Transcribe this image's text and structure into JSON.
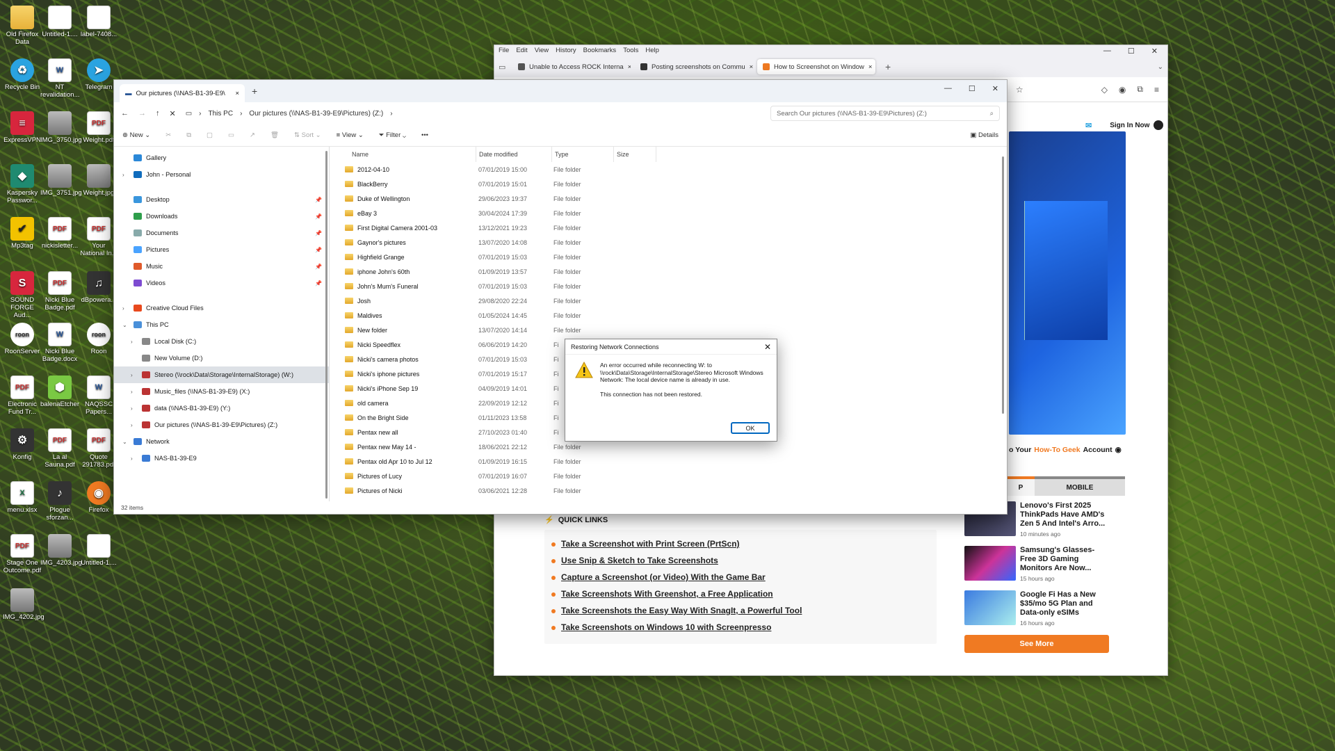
{
  "desktop": {
    "icons": [
      {
        "label": "Old Firefox Data",
        "icon": "folder-icon"
      },
      {
        "label": "Untitled-1....",
        "icon": "document-icon"
      },
      {
        "label": "label-7408...",
        "icon": "document-icon"
      },
      {
        "label": "Recycle Bin",
        "icon": "recycle-bin-icon"
      },
      {
        "label": "NT revalidation...",
        "icon": "word-icon"
      },
      {
        "label": "Telegram",
        "icon": "telegram-icon"
      },
      {
        "label": "ExpressVPN",
        "icon": "expressvpn-icon"
      },
      {
        "label": "IMG_3750.jpg",
        "icon": "image-icon"
      },
      {
        "label": "Weight.pdf",
        "icon": "pdf-icon"
      },
      {
        "label": "Kaspersky Passwor...",
        "icon": "kaspersky-icon"
      },
      {
        "label": "IMG_3751.jpg",
        "icon": "image-icon"
      },
      {
        "label": "Weight.jpg",
        "icon": "image-icon"
      },
      {
        "label": "Mp3tag",
        "icon": "mp3tag-icon"
      },
      {
        "label": "nickisletter...",
        "icon": "pdf-icon"
      },
      {
        "label": "Your National In...",
        "icon": "pdf-icon"
      },
      {
        "label": "SOUND FORGE Aud...",
        "icon": "sound-forge-icon"
      },
      {
        "label": "Nicki Blue Badge.pdf",
        "icon": "pdf-icon"
      },
      {
        "label": "dBpowera...",
        "icon": "dbpoweramp-icon"
      },
      {
        "label": "RoonServer",
        "icon": "roon-icon"
      },
      {
        "label": "Nicki Blue Badge.docx",
        "icon": "word-icon"
      },
      {
        "label": "Roon",
        "icon": "roon-icon"
      },
      {
        "label": "Electronic Fund Tr...",
        "icon": "pdf-icon"
      },
      {
        "label": "balenaEtcher",
        "icon": "balena-icon"
      },
      {
        "label": "NAQSSC Papers...",
        "icon": "word-icon"
      },
      {
        "label": "Konfig",
        "icon": "konfig-icon"
      },
      {
        "label": "La al Sauna.pdf",
        "icon": "pdf-icon"
      },
      {
        "label": "Quote 291783.pdf",
        "icon": "pdf-icon"
      },
      {
        "label": "menu.xlsx",
        "icon": "excel-icon"
      },
      {
        "label": "Plogue sforzan...",
        "icon": "plogue-icon"
      },
      {
        "label": "Firefox",
        "icon": "firefox-icon"
      },
      {
        "label": "Stage One Outcome.pdf",
        "icon": "pdf-icon"
      },
      {
        "label": "IMG_4203.jpg",
        "icon": "image-icon"
      },
      {
        "label": "Untitled-1....",
        "icon": "document-icon"
      },
      {
        "label": "IMG_4202.jpg",
        "icon": "image-icon"
      }
    ]
  },
  "browser": {
    "menu": [
      "File",
      "Edit",
      "View",
      "History",
      "Bookmarks",
      "Tools",
      "Help"
    ],
    "tabs": [
      {
        "label": "Unable to Access ROCK Interna",
        "close": "×"
      },
      {
        "label": "Posting screenshots on Commu",
        "close": "×"
      },
      {
        "label": "How to Screenshot on Window",
        "close": "×"
      }
    ],
    "new_tab": "+",
    "sign_in": "Sign In Now",
    "newsletter": {
      "prefix": "o Your",
      "brand": "How-To Geek",
      "suffix": "Account"
    },
    "rail_tabs": {
      "first": "P",
      "second": "MOBILE"
    },
    "quick_links": {
      "title": "QUICK LINKS",
      "items": [
        "Take a Screenshot with Print Screen (PrtScn)",
        "Use Snip & Sketch to Take Screenshots",
        "Capture a Screenshot (or Video) With the Game Bar",
        "Take Screenshots With Greenshot, a Free Application",
        "Take Screenshots the Easy Way With SnagIt, a Powerful Tool",
        "Take Screenshots on Windows 10 with Screenpresso"
      ]
    },
    "stories": [
      {
        "headline": "Lenovo's First 2025 ThinkPads Have AMD's Zen 5 And Intel's Arro...",
        "time": "10 minutes ago"
      },
      {
        "headline": "Samsung's Glasses-Free 3D Gaming Monitors Are Now...",
        "time": "15 hours ago"
      },
      {
        "headline": "Google Fi Has a New $35/mo 5G Plan and Data-only eSIMs",
        "time": "16 hours ago"
      }
    ],
    "see_more": "See More",
    "colors": {
      "accent": "#f07a22"
    }
  },
  "explorer": {
    "tab_title": "Our pictures (\\\\NAS-B1-39-E9\\",
    "tab_close": "×",
    "new_tab": "+",
    "breadcrumb": [
      "This PC",
      "Our pictures (\\\\NAS-B1-39-E9\\Pictures) (Z:)"
    ],
    "search_placeholder": "Search Our pictures (\\\\NAS-B1-39-E9\\Pictures) (Z:)",
    "toolbar": {
      "new": "New",
      "sort": "Sort",
      "view": "View",
      "filter": "Filter",
      "more": "•••",
      "details": "Details"
    },
    "nav": [
      {
        "label": "Gallery",
        "icon": "gallery-icon",
        "chev": "",
        "pin": false
      },
      {
        "label": "John - Personal",
        "icon": "onedrive-icon",
        "chev": "›",
        "pin": false
      },
      {
        "sep": true
      },
      {
        "label": "Desktop",
        "icon": "desktop-icon",
        "chev": "",
        "pin": true
      },
      {
        "label": "Downloads",
        "icon": "downloads-icon",
        "chev": "",
        "pin": true
      },
      {
        "label": "Documents",
        "icon": "documents-icon",
        "chev": "",
        "pin": true
      },
      {
        "label": "Pictures",
        "icon": "pictures-icon",
        "chev": "",
        "pin": true
      },
      {
        "label": "Music",
        "icon": "music-icon",
        "chev": "",
        "pin": true
      },
      {
        "label": "Videos",
        "icon": "videos-icon",
        "chev": "",
        "pin": true
      },
      {
        "sep": true
      },
      {
        "label": "Creative Cloud Files",
        "icon": "creative-cloud-icon",
        "chev": "›",
        "pin": false
      },
      {
        "label": "This PC",
        "icon": "this-pc-icon",
        "chev": "⌄",
        "pin": false
      },
      {
        "label": "Local Disk (C:)",
        "icon": "drive-icon",
        "chev": "›",
        "pin": false,
        "indent": 1
      },
      {
        "label": "New Volume (D:)",
        "icon": "drive-icon",
        "chev": "",
        "pin": false,
        "indent": 1
      },
      {
        "label": "Stereo (\\\\rock\\Data\\Storage\\InternalStorage) (W:)",
        "icon": "network-drive-icon",
        "chev": "›",
        "pin": false,
        "indent": 1,
        "selected": true
      },
      {
        "label": "Music_files (\\\\NAS-B1-39-E9) (X:)",
        "icon": "network-drive-icon",
        "chev": "›",
        "pin": false,
        "indent": 1
      },
      {
        "label": "data (\\\\NAS-B1-39-E9) (Y:)",
        "icon": "network-drive-icon",
        "chev": "›",
        "pin": false,
        "indent": 1
      },
      {
        "label": "Our pictures (\\\\NAS-B1-39-E9\\Pictures) (Z:)",
        "icon": "network-drive-icon",
        "chev": "›",
        "pin": false,
        "indent": 1
      },
      {
        "label": "Network",
        "icon": "network-icon",
        "chev": "⌄",
        "pin": false
      },
      {
        "label": "NAS-B1-39-E9",
        "icon": "computer-icon",
        "chev": "›",
        "pin": false,
        "indent": 1
      }
    ],
    "columns": [
      "Name",
      "Date modified",
      "Type",
      "Size"
    ],
    "files": [
      {
        "name": "2012-04-10",
        "date": "07/01/2019 15:00",
        "type": "File folder"
      },
      {
        "name": "BlackBerry",
        "date": "07/01/2019 15:01",
        "type": "File folder"
      },
      {
        "name": "Duke of Wellington",
        "date": "29/06/2023 19:37",
        "type": "File folder"
      },
      {
        "name": "eBay 3",
        "date": "30/04/2024 17:39",
        "type": "File folder"
      },
      {
        "name": "First Digital Camera 2001-03",
        "date": "13/12/2021 19:23",
        "type": "File folder"
      },
      {
        "name": "Gaynor's pictures",
        "date": "13/07/2020 14:08",
        "type": "File folder"
      },
      {
        "name": "Highfield Grange",
        "date": "07/01/2019 15:03",
        "type": "File folder"
      },
      {
        "name": "iphone John's 60th",
        "date": "01/09/2019 13:57",
        "type": "File folder"
      },
      {
        "name": "John's Mum's Funeral",
        "date": "07/01/2019 15:03",
        "type": "File folder"
      },
      {
        "name": "Josh",
        "date": "29/08/2020 22:24",
        "type": "File folder"
      },
      {
        "name": "Maldives",
        "date": "01/05/2024 14:45",
        "type": "File folder"
      },
      {
        "name": "New folder",
        "date": "13/07/2020 14:14",
        "type": "File folder"
      },
      {
        "name": "Nicki Speedflex",
        "date": "06/06/2019 14:20",
        "type": "Fi"
      },
      {
        "name": "Nicki's camera photos",
        "date": "07/01/2019 15:03",
        "type": "Fi"
      },
      {
        "name": "Nicki's iphone pictures",
        "date": "07/01/2019 15:17",
        "type": "Fi"
      },
      {
        "name": "Nicki's iPhone Sep 19",
        "date": "04/09/2019 14:01",
        "type": "Fi"
      },
      {
        "name": "old camera",
        "date": "22/09/2019 12:12",
        "type": "Fi"
      },
      {
        "name": "On the Bright Side",
        "date": "01/11/2023 13:58",
        "type": "Fi"
      },
      {
        "name": "Pentax new all",
        "date": "27/10/2023 01:40",
        "type": "Fi"
      },
      {
        "name": "Pentax new May 14 -",
        "date": "18/06/2021 22:12",
        "type": "File folder"
      },
      {
        "name": "Pentax old  Apr 10 to Jul 12",
        "date": "01/09/2019 16:15",
        "type": "File folder"
      },
      {
        "name": "Pictures of Lucy",
        "date": "07/01/2019 16:07",
        "type": "File folder"
      },
      {
        "name": "Pictures of Nicki",
        "date": "03/06/2021 12:28",
        "type": "File folder"
      }
    ],
    "status": "32 items"
  },
  "dialog": {
    "title": "Restoring Network Connections",
    "close": "✕",
    "message": "An error occurred while reconnecting W: to \\\\rock\\Data\\Storage\\InternalStorage\\Stereo Microsoft Windows Network: The local device name is already in use.",
    "message2": "This connection has not been restored.",
    "ok": "OK"
  }
}
